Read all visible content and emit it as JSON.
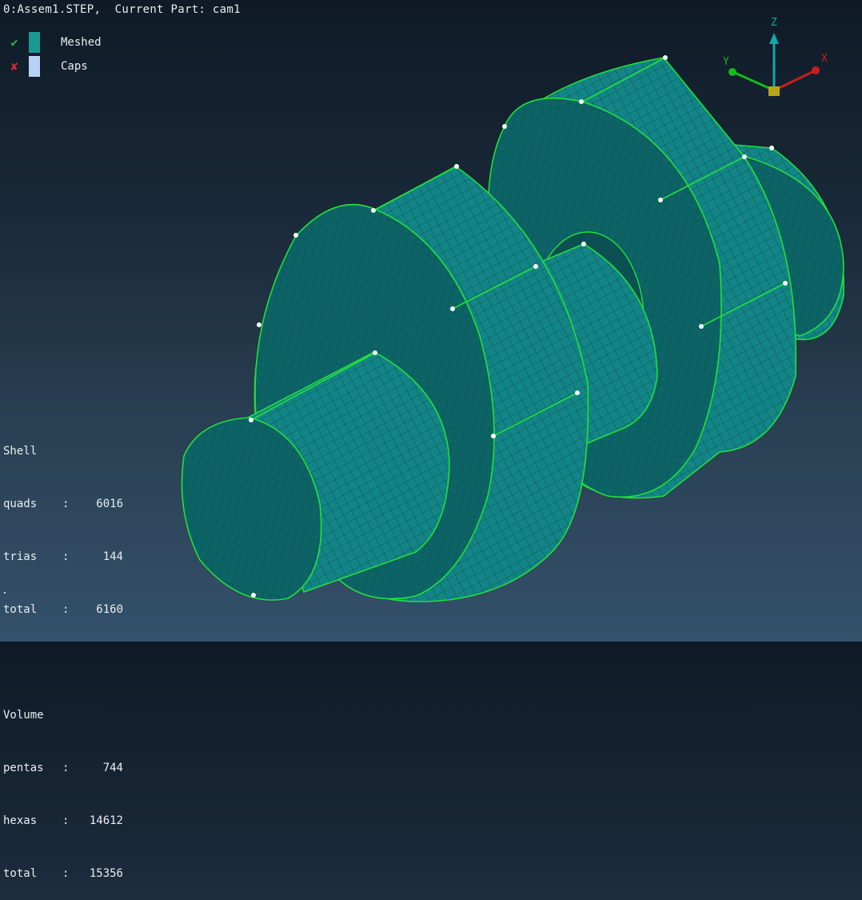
{
  "header": {
    "model": "0:Assem1.STEP,",
    "part_label": "Current Part:",
    "part_name": "cam1"
  },
  "legend": [
    {
      "status": "check-icon",
      "status_color": "#22bb33",
      "swatch_color": "#1a9a92",
      "label": "Meshed"
    },
    {
      "status": "cross-icon",
      "status_color": "#d03030",
      "swatch_color": "#b8d2f4",
      "label": "Caps"
    }
  ],
  "stats": {
    "shell": {
      "title": "Shell",
      "rows": [
        {
          "key": "quads",
          "value": "6016"
        },
        {
          "key": "trias",
          "value": "144"
        },
        {
          "key": "total",
          "value": "6160"
        }
      ]
    },
    "volume": {
      "title": "Volume",
      "rows": [
        {
          "key": "pentas",
          "value": "744"
        },
        {
          "key": "hexas",
          "value": "14612"
        },
        {
          "key": "total",
          "value": "15356"
        }
      ]
    },
    "separator": ":"
  },
  "axes": {
    "x_label": "X",
    "y_label": "Y",
    "z_label": "Z",
    "x_color": "#c81e1e",
    "y_color": "#16b81e",
    "z_color": "#10a8a8",
    "origin_color": "#b9a413"
  },
  "mesh_colors": {
    "fill": "#138586",
    "fill_dark": "#0d6466",
    "fill_shadow": "#0a4f52",
    "grid": "#0a4b4c",
    "edge": "#22e03a",
    "node": "#ffffff"
  }
}
